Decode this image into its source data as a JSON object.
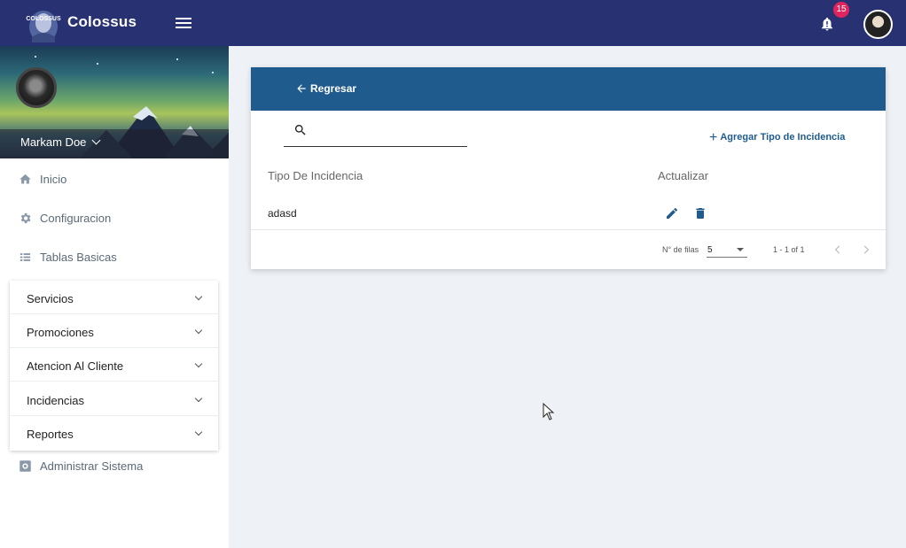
{
  "app": {
    "brand": "Colossus",
    "logo_text": "COLOSSUS"
  },
  "topbar": {
    "notification_count": "15"
  },
  "sidebar": {
    "user_name": "Markam Doe",
    "items": [
      {
        "label": "Inicio",
        "icon": "home-icon"
      },
      {
        "label": "Configuracion",
        "icon": "gear-icon"
      },
      {
        "label": "Tablas Basicas",
        "icon": "list-icon"
      }
    ],
    "sub_items": [
      {
        "label": "Servicios"
      },
      {
        "label": "Promociones"
      },
      {
        "label": "Atencion Al Cliente"
      },
      {
        "label": "Incidencias"
      },
      {
        "label": "Reportes"
      }
    ],
    "admin": {
      "label": "Administrar Sistema",
      "icon": "settings-box-icon"
    }
  },
  "main": {
    "back_label": "Regresar",
    "search": {
      "value": "",
      "placeholder": ""
    },
    "add_label": "Agregar Tipo de Incidencia",
    "table": {
      "headers": [
        "Tipo De Incidencia",
        "Actualizar"
      ],
      "rows": [
        {
          "tipo": "adasd"
        }
      ]
    },
    "pager": {
      "rows_label": "N° de filas",
      "rows_value": "5",
      "range": "1 - 1 of 1"
    }
  },
  "colors": {
    "topbar": "#283272",
    "card_header": "#1f5b8c",
    "accent": "#1f5b8c",
    "badge": "#e0245e"
  }
}
